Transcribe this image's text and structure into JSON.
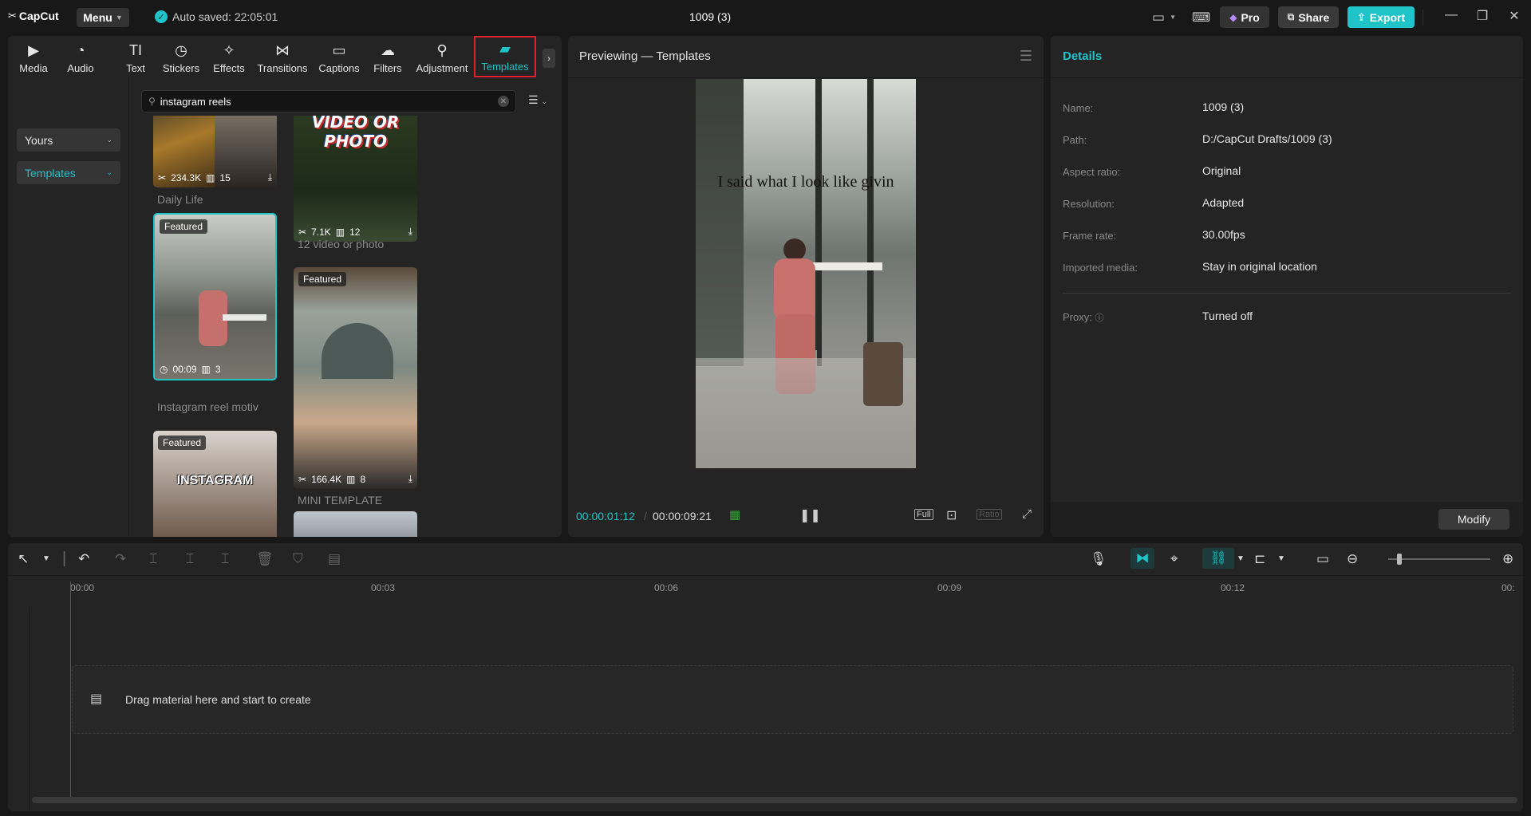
{
  "app": {
    "logo": "CapCut",
    "menu_label": "Menu",
    "autosave": "Auto saved: 22:05:01",
    "title": "1009 (3)"
  },
  "topbar": {
    "pro_label": "Pro",
    "share_label": "Share",
    "export_label": "Export"
  },
  "tabs": [
    {
      "label": "Media",
      "icon": "media-icon"
    },
    {
      "label": "Audio",
      "icon": "audio-icon"
    },
    {
      "label": "Text",
      "icon": "text-icon"
    },
    {
      "label": "Stickers",
      "icon": "stickers-icon"
    },
    {
      "label": "Effects",
      "icon": "effects-icon"
    },
    {
      "label": "Transitions",
      "icon": "transitions-icon"
    },
    {
      "label": "Captions",
      "icon": "captions-icon"
    },
    {
      "label": "Filters",
      "icon": "filters-icon"
    },
    {
      "label": "Adjustment",
      "icon": "adjustment-icon"
    },
    {
      "label": "Templates",
      "icon": "templates-icon",
      "active": true
    }
  ],
  "sidebar": {
    "items": [
      {
        "label": "Yours"
      },
      {
        "label": "Templates",
        "selected": true
      }
    ]
  },
  "search": {
    "value": "instagram reels"
  },
  "templates": [
    {
      "title": "Daily Life",
      "uses": "234.3K",
      "clips": "15"
    },
    {
      "title": "12 video or photo",
      "overlay_text": "VIDEO OR PHOTO",
      "uses": "7.1K",
      "clips": "12"
    },
    {
      "title": "Instagram reel motiv",
      "badge": "Featured",
      "duration": "00:09",
      "clips": "3",
      "selected": true
    },
    {
      "title": "MINI TEMPLATE",
      "badge": "Featured",
      "uses": "166.4K",
      "clips": "8"
    },
    {
      "title": "",
      "badge": "Featured",
      "overlay_text": "INSTAGRAM"
    }
  ],
  "preview": {
    "title": "Previewing — Templates",
    "caption": "I said what I look like givin",
    "current_time": "00:00:01:12",
    "separator": "/",
    "total_time": "00:00:09:21",
    "full_label": "Full",
    "ratio_label": "Ratio"
  },
  "details": {
    "title": "Details",
    "rows": [
      {
        "k": "Name:",
        "v": "1009 (3)"
      },
      {
        "k": "Path:",
        "v": "D:/CapCut Drafts/1009 (3)"
      },
      {
        "k": "Aspect ratio:",
        "v": "Original"
      },
      {
        "k": "Resolution:",
        "v": "Adapted"
      },
      {
        "k": "Frame rate:",
        "v": "30.00fps"
      },
      {
        "k": "Imported media:",
        "v": "Stay in original location"
      },
      {
        "k": "Proxy:",
        "v": "Turned off"
      }
    ],
    "modify_label": "Modify"
  },
  "timeline": {
    "ruler": [
      "00:00",
      "00:03",
      "00:06",
      "00:09",
      "00:12",
      "00:"
    ],
    "drop_text": "Drag material here and start to create"
  },
  "colors": {
    "accent": "#1fc4c9",
    "export_bg": "#1fc4c9",
    "active_border": "#e0202a"
  }
}
